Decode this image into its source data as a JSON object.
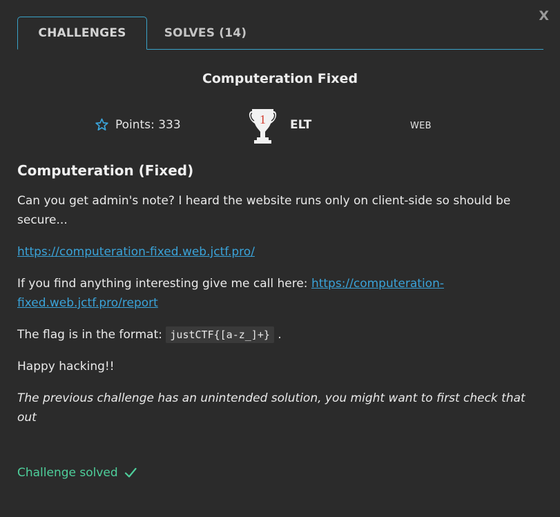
{
  "close_label": "X",
  "tabs": [
    {
      "label": "CHALLENGES"
    },
    {
      "label": "SOLVES (14)"
    }
  ],
  "challenge": {
    "title": "Computeration Fixed",
    "points": "Points: 333",
    "trophy_rank": "1",
    "team": "ELT",
    "category": "WEB",
    "heading": "Computeration (Fixed)",
    "intro": "Can you get admin's note? I heard the website runs only on client-side so should be secure...",
    "url": "https://computeration-fixed.web.jctf.pro/",
    "report_prefix": "If you find anything interesting give me call here: ",
    "report_url": "https://computeration-fixed.web.jctf.pro/report",
    "flag_prefix": "The flag is in the format: ",
    "flag_format": "justCTF{[a-z_]+}",
    "flag_suffix": ".",
    "closing": "Happy hacking!!",
    "note": "The previous challenge has an unintended solution, you might want to first check that out",
    "status": "Challenge solved"
  },
  "colors": {
    "accent": "#3aa3c9",
    "link": "#3aa3d9",
    "success": "#4ecf9b"
  },
  "icons": {
    "points": "star-outline-icon",
    "trophy": "trophy-icon",
    "status": "check-icon"
  }
}
